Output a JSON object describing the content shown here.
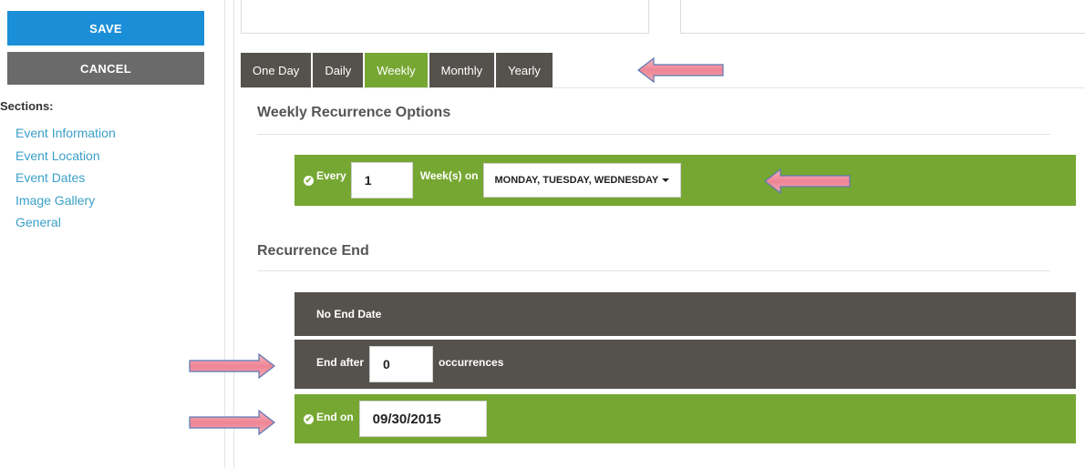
{
  "sidebar": {
    "save_label": "SAVE",
    "cancel_label": "CANCEL",
    "sections_label": "Sections:",
    "items": [
      {
        "label": "Event Information"
      },
      {
        "label": "Event Location"
      },
      {
        "label": "Event Dates"
      },
      {
        "label": "Image Gallery"
      },
      {
        "label": "General"
      }
    ]
  },
  "tabs": [
    {
      "label": "One Day",
      "active": false
    },
    {
      "label": "Daily",
      "active": false
    },
    {
      "label": "Weekly",
      "active": true
    },
    {
      "label": "Monthly",
      "active": false
    },
    {
      "label": "Yearly",
      "active": false
    }
  ],
  "weekly": {
    "heading": "Weekly Recurrence Options",
    "every_label": "Every",
    "every_value": "1",
    "weeks_on_label": "Week(s) on",
    "days_selected": "MONDAY, TUESDAY, WEDNESDAY"
  },
  "recurrence_end": {
    "heading": "Recurrence End",
    "no_end_label": "No End Date",
    "end_after_label": "End after",
    "end_after_value": "0",
    "occurrences_label": "occurrences",
    "end_on_label": "End on",
    "end_on_value": "09/30/2015"
  },
  "colors": {
    "save_blue": "#1b8ed8",
    "active_green": "#76a732",
    "tab_dark": "#55524d",
    "link_blue": "#3a9fc8",
    "arrow_pink": "#f08c9a"
  }
}
